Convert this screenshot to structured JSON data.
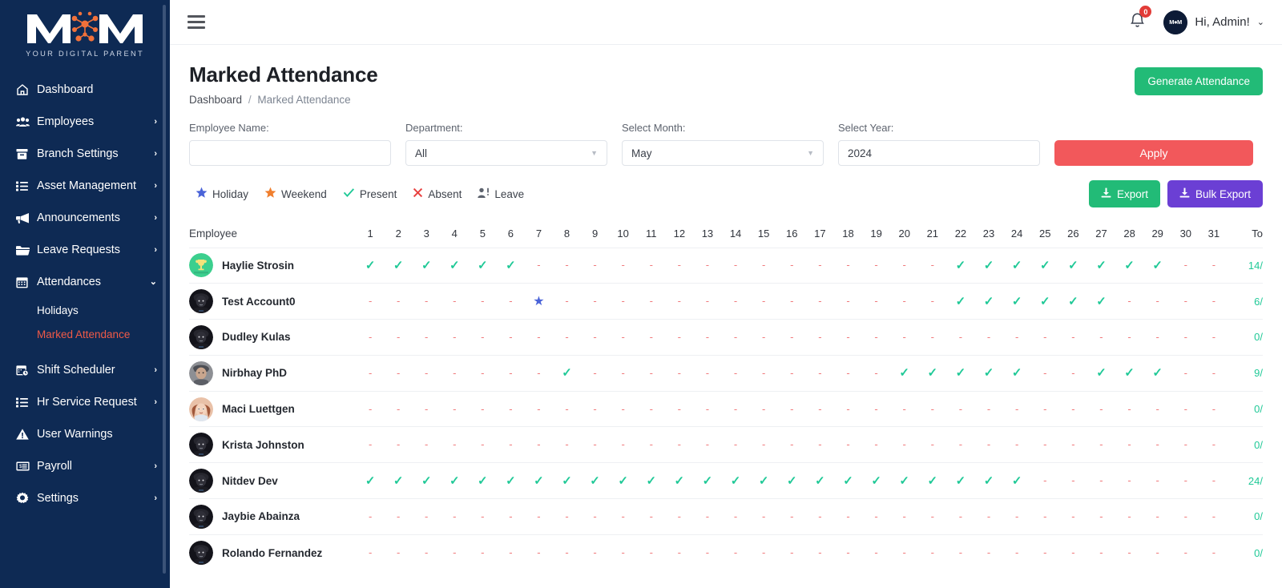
{
  "sidebar": {
    "logo_tagline": "YOUR DIGITAL PARENT",
    "items": [
      {
        "label": "Dashboard",
        "icon": "home-icon",
        "chevron": "",
        "active": false
      },
      {
        "label": "Employees",
        "icon": "users-icon",
        "chevron": "›",
        "active": false
      },
      {
        "label": "Branch Settings",
        "icon": "archive-icon",
        "chevron": "›",
        "active": false
      },
      {
        "label": "Asset Management",
        "icon": "list-icon",
        "chevron": "›",
        "active": false
      },
      {
        "label": "Announcements",
        "icon": "megaphone-icon",
        "chevron": "›",
        "active": false
      },
      {
        "label": "Leave Requests",
        "icon": "folder-icon",
        "chevron": "›",
        "active": false
      },
      {
        "label": "Attendances",
        "icon": "calendar-icon",
        "chevron": "⌄",
        "active": false
      }
    ],
    "sub_items": [
      {
        "label": "Holidays",
        "active": false
      },
      {
        "label": "Marked Attendance",
        "active": true
      }
    ],
    "items_bottom": [
      {
        "label": "Shift Scheduler",
        "icon": "calendar-clock-icon",
        "chevron": "›"
      },
      {
        "label": "Hr Service Request",
        "icon": "list-icon",
        "chevron": "›"
      },
      {
        "label": "User Warnings",
        "icon": "warning-icon",
        "chevron": ""
      },
      {
        "label": "Payroll",
        "icon": "money-card-icon",
        "chevron": "›"
      },
      {
        "label": "Settings",
        "icon": "gear-icon",
        "chevron": "›"
      }
    ]
  },
  "topbar": {
    "menu_icon": "hamburger-icon",
    "notification_icon": "bell-icon",
    "notification_count": "0",
    "avatar_text": "MM",
    "greeting": "Hi, Admin!",
    "caret": "⌄"
  },
  "page": {
    "title": "Marked Attendance",
    "breadcrumb_root": "Dashboard",
    "breadcrumb_sep": "/",
    "breadcrumb_current": "Marked Attendance",
    "generate_button": "Generate Attendance"
  },
  "filters": {
    "employee_label": "Employee Name:",
    "employee_value": "",
    "employee_placeholder": "",
    "department_label": "Department:",
    "department_value": "All",
    "month_label": "Select Month:",
    "month_value": "May",
    "year_label": "Select Year:",
    "year_value": "2024",
    "apply_label": "Apply"
  },
  "legend": [
    {
      "label": "Holiday",
      "icon": "star-icon",
      "color": "#4a63d8"
    },
    {
      "label": "Weekend",
      "icon": "star-icon",
      "color": "#f07f2e"
    },
    {
      "label": "Present",
      "icon": "check-icon",
      "color": "#20c997"
    },
    {
      "label": "Absent",
      "icon": "cross-icon",
      "color": "#e8413f"
    },
    {
      "label": "Leave",
      "icon": "person-alert-icon",
      "color": "#5d636e"
    }
  ],
  "actions": {
    "export_label": "Export",
    "bulk_export_label": "Bulk Export",
    "download_icon": "download-icon"
  },
  "table": {
    "employee_header": "Employee",
    "days": [
      "1",
      "2",
      "3",
      "4",
      "5",
      "6",
      "7",
      "8",
      "9",
      "10",
      "11",
      "12",
      "13",
      "14",
      "15",
      "16",
      "17",
      "18",
      "19",
      "20",
      "21",
      "22",
      "23",
      "24",
      "25",
      "26",
      "27",
      "28",
      "29",
      "30",
      "31"
    ],
    "total_header": "To",
    "rows": [
      {
        "name": "Haylie Strosin",
        "avatar": "green-trophy-avatar",
        "total": "14/",
        "marks": [
          "P",
          "P",
          "P",
          "P",
          "P",
          "P",
          "A",
          "A",
          "A",
          "A",
          "A",
          "A",
          "A",
          "A",
          "A",
          "A",
          "A",
          "A",
          "A",
          "A",
          "A",
          "P",
          "P",
          "P",
          "P",
          "P",
          "P",
          "P",
          "P",
          "A",
          "A"
        ]
      },
      {
        "name": "Test Account0",
        "avatar": "dark-person-avatar",
        "total": "6/",
        "marks": [
          "A",
          "A",
          "A",
          "A",
          "A",
          "A",
          "H",
          "A",
          "A",
          "A",
          "A",
          "A",
          "A",
          "A",
          "A",
          "A",
          "A",
          "A",
          "A",
          "A",
          "A",
          "P",
          "P",
          "P",
          "P",
          "P",
          "P",
          "A",
          "A",
          "A",
          "A"
        ]
      },
      {
        "name": "Dudley Kulas",
        "avatar": "dark-person-avatar",
        "total": "0/",
        "marks": [
          "A",
          "A",
          "A",
          "A",
          "A",
          "A",
          "A",
          "A",
          "A",
          "A",
          "A",
          "A",
          "A",
          "A",
          "A",
          "A",
          "A",
          "A",
          "A",
          "A",
          "A",
          "A",
          "A",
          "A",
          "A",
          "A",
          "A",
          "A",
          "A",
          "A",
          "A"
        ]
      },
      {
        "name": "Nirbhay PhD",
        "avatar": "grey-person-avatar",
        "total": "9/",
        "marks": [
          "A",
          "A",
          "A",
          "A",
          "A",
          "A",
          "A",
          "P",
          "A",
          "A",
          "A",
          "A",
          "A",
          "A",
          "A",
          "A",
          "A",
          "A",
          "A",
          "P",
          "P",
          "P",
          "P",
          "P",
          "A",
          "A",
          "P",
          "P",
          "P",
          "A",
          "A"
        ]
      },
      {
        "name": "Maci Luettgen",
        "avatar": "female-avatar",
        "total": "0/",
        "marks": [
          "A",
          "A",
          "A",
          "A",
          "A",
          "A",
          "A",
          "A",
          "A",
          "A",
          "A",
          "A",
          "A",
          "A",
          "A",
          "A",
          "A",
          "A",
          "A",
          "A",
          "A",
          "A",
          "A",
          "A",
          "A",
          "A",
          "A",
          "A",
          "A",
          "A",
          "A"
        ]
      },
      {
        "name": "Krista Johnston",
        "avatar": "dark-person-avatar",
        "total": "0/",
        "marks": [
          "A",
          "A",
          "A",
          "A",
          "A",
          "A",
          "A",
          "A",
          "A",
          "A",
          "A",
          "A",
          "A",
          "A",
          "A",
          "A",
          "A",
          "A",
          "A",
          "A",
          "A",
          "A",
          "A",
          "A",
          "A",
          "A",
          "A",
          "A",
          "A",
          "A",
          "A"
        ]
      },
      {
        "name": "Nitdev Dev",
        "avatar": "dark-person-avatar",
        "total": "24/",
        "marks": [
          "P",
          "P",
          "P",
          "P",
          "P",
          "P",
          "P",
          "P",
          "P",
          "P",
          "P",
          "P",
          "P",
          "P",
          "P",
          "P",
          "P",
          "P",
          "P",
          "P",
          "P",
          "P",
          "P",
          "P",
          "A",
          "A",
          "A",
          "A",
          "A",
          "A",
          "A"
        ]
      },
      {
        "name": "Jaybie Abainza",
        "avatar": "dark-person-avatar",
        "total": "0/",
        "marks": [
          "A",
          "A",
          "A",
          "A",
          "A",
          "A",
          "A",
          "A",
          "A",
          "A",
          "A",
          "A",
          "A",
          "A",
          "A",
          "A",
          "A",
          "A",
          "A",
          "A",
          "A",
          "A",
          "A",
          "A",
          "A",
          "A",
          "A",
          "A",
          "A",
          "A",
          "A"
        ]
      },
      {
        "name": "Rolando Fernandez",
        "avatar": "dark-person-avatar",
        "total": "0/",
        "marks": [
          "A",
          "A",
          "A",
          "A",
          "A",
          "A",
          "A",
          "A",
          "A",
          "A",
          "A",
          "A",
          "A",
          "A",
          "A",
          "A",
          "A",
          "A",
          "A",
          "A",
          "A",
          "A",
          "A",
          "A",
          "A",
          "A",
          "A",
          "A",
          "A",
          "A",
          "A"
        ]
      }
    ]
  },
  "colors": {
    "sidebar_bg": "#0e2a54",
    "active_item": "#f05a47",
    "present": "#20c997",
    "absent": "#f07a7c",
    "holiday": "#4a63d8",
    "apply": "#f2585b",
    "generate": "#22bb77",
    "bulk_export": "#6b3fd4"
  }
}
